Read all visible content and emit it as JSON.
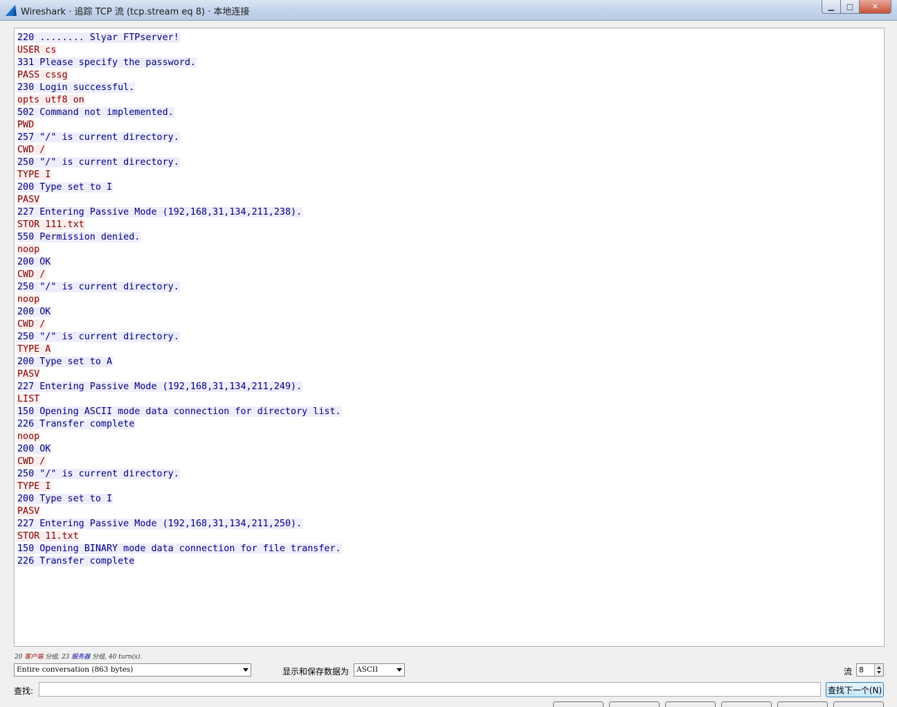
{
  "window": {
    "title": "Wireshark · 追踪 TCP 流 (tcp.stream eq 8) · 本地连接",
    "min_label": "▁",
    "max_label": "□",
    "close_label": "✕"
  },
  "stream": {
    "lines": [
      {
        "side": "server",
        "text": "220 ........ Slyar FTPserver!"
      },
      {
        "side": "client",
        "text": "USER cs"
      },
      {
        "side": "server",
        "text": "331 Please specify the password."
      },
      {
        "side": "client",
        "text": "PASS cssg"
      },
      {
        "side": "server",
        "text": "230 Login successful."
      },
      {
        "side": "client",
        "text": "opts utf8 on"
      },
      {
        "side": "server",
        "text": "502 Command not implemented."
      },
      {
        "side": "client",
        "text": "PWD"
      },
      {
        "side": "server",
        "text": "257 \"/\" is current directory."
      },
      {
        "side": "client",
        "text": "CWD /"
      },
      {
        "side": "server",
        "text": "250 \"/\" is current directory."
      },
      {
        "side": "client",
        "text": "TYPE I"
      },
      {
        "side": "server",
        "text": "200 Type set to I"
      },
      {
        "side": "client",
        "text": "PASV"
      },
      {
        "side": "server",
        "text": "227 Entering Passive Mode (192,168,31,134,211,238)."
      },
      {
        "side": "client",
        "text": "STOR 111.txt"
      },
      {
        "side": "server",
        "text": "550 Permission denied."
      },
      {
        "side": "client",
        "text": "noop"
      },
      {
        "side": "server",
        "text": "200 OK"
      },
      {
        "side": "client",
        "text": "CWD /"
      },
      {
        "side": "server",
        "text": "250 \"/\" is current directory."
      },
      {
        "side": "client",
        "text": "noop"
      },
      {
        "side": "server",
        "text": "200 OK"
      },
      {
        "side": "client",
        "text": "CWD /"
      },
      {
        "side": "server",
        "text": "250 \"/\" is current directory."
      },
      {
        "side": "client",
        "text": "TYPE A"
      },
      {
        "side": "server",
        "text": "200 Type set to A"
      },
      {
        "side": "client",
        "text": "PASV"
      },
      {
        "side": "server",
        "text": "227 Entering Passive Mode (192,168,31,134,211,249)."
      },
      {
        "side": "client",
        "text": "LIST"
      },
      {
        "side": "server",
        "text": "150 Opening ASCII mode data connection for directory list."
      },
      {
        "side": "server",
        "text": "226 Transfer complete"
      },
      {
        "side": "client",
        "text": "noop"
      },
      {
        "side": "server",
        "text": "200 OK"
      },
      {
        "side": "client",
        "text": "CWD /"
      },
      {
        "side": "server",
        "text": "250 \"/\" is current directory."
      },
      {
        "side": "client",
        "text": "TYPE I"
      },
      {
        "side": "server",
        "text": "200 Type set to I"
      },
      {
        "side": "client",
        "text": "PASV"
      },
      {
        "side": "server",
        "text": "227 Entering Passive Mode (192,168,31,134,211,250)."
      },
      {
        "side": "client",
        "text": "STOR 11.txt"
      },
      {
        "side": "server",
        "text": "150 Opening BINARY mode data connection for file transfer."
      },
      {
        "side": "server",
        "text": "226 Transfer complete"
      }
    ]
  },
  "stats": {
    "client_count": "20",
    "client_label": "客户端",
    "sep1": " 分组, ",
    "server_count": "23",
    "server_label": "服务器",
    "sep2": " 分组, 40 turn(s)."
  },
  "controls": {
    "conversation_select": "Entire conversation (863 bytes)",
    "show_as_label": "显示和保存数据为",
    "format_select": "ASCII",
    "stream_label": "流",
    "stream_value": "8",
    "find_label": "查找:",
    "find_value": "",
    "find_next_label": "查找下一个(N)"
  },
  "colors": {
    "client_fg": "#7f0000",
    "client_bg": "#fbeded",
    "server_fg": "#00007f",
    "server_bg": "#ededfb"
  }
}
